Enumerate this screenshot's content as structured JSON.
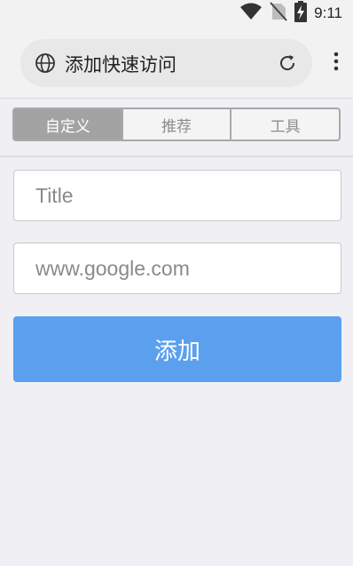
{
  "status_bar": {
    "time": "9:11",
    "icons": [
      "wifi-icon",
      "no-sim-icon",
      "battery-charging-icon"
    ]
  },
  "browser": {
    "page_title": "添加快速访问",
    "left_icon": "globe-icon",
    "right_icon": "reload-icon",
    "menu_icon": "more-vert-icon"
  },
  "tabs": [
    {
      "label": "自定义",
      "active": true
    },
    {
      "label": "推荐",
      "active": false
    },
    {
      "label": "工具",
      "active": false
    }
  ],
  "form": {
    "title_placeholder": "Title",
    "url_placeholder": "www.google.com",
    "add_label": "添加"
  },
  "colors": {
    "accent": "#5aa0ee",
    "active_tab": "#a3a3a3",
    "background": "#efeff4"
  }
}
